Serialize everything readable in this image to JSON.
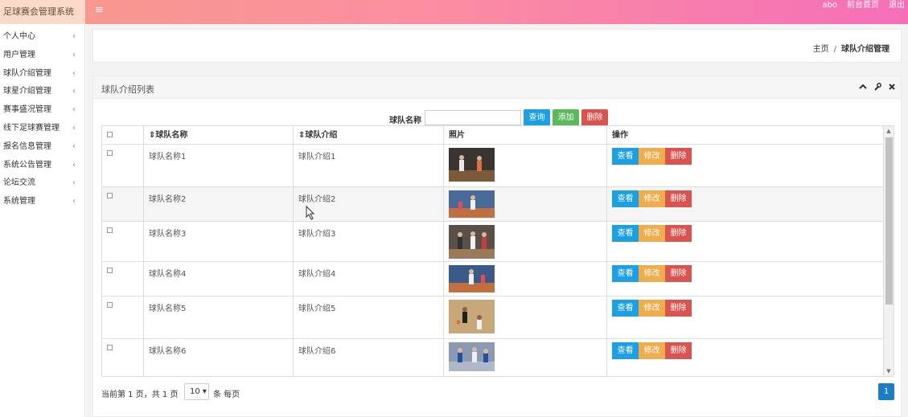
{
  "app": {
    "title": "足球赛会管理系统",
    "menu_icon": "hamburger-icon"
  },
  "top_nav": {
    "user": "abo",
    "front_page": "前台首页",
    "logout": "退出"
  },
  "sidebar": {
    "items": [
      {
        "label": "个人中心"
      },
      {
        "label": "用户管理"
      },
      {
        "label": "球队介绍管理"
      },
      {
        "label": "球星介绍管理"
      },
      {
        "label": "赛事盛况管理"
      },
      {
        "label": "线下足球赛管理"
      },
      {
        "label": "报名信息管理"
      },
      {
        "label": "系统公告管理"
      },
      {
        "label": "论坛交流"
      },
      {
        "label": "系统管理"
      }
    ],
    "chevron": "‹"
  },
  "breadcrumb": {
    "home": "主页",
    "separator": "/",
    "current": "球队介绍管理"
  },
  "panel": {
    "title": "球队介绍列表",
    "tools": {
      "collapse": "⌃",
      "wrench": "🔧",
      "close": "✖"
    }
  },
  "search": {
    "label": "球队名称",
    "value": "",
    "placeholder": "",
    "query_btn": "查询",
    "add_btn": "添加",
    "delete_btn": "删除"
  },
  "table": {
    "headers": {
      "name": "⇕球队名称",
      "intro": "⇕球队介绍",
      "photo": "照片",
      "ops": "操作"
    },
    "actions": {
      "view": "查看",
      "edit": "修改",
      "delete": "删除"
    },
    "rows": [
      {
        "name": "球队名称1",
        "intro": "球队介绍1"
      },
      {
        "name": "球队名称2",
        "intro": "球队介绍2"
      },
      {
        "name": "球队名称3",
        "intro": "球队介绍3"
      },
      {
        "name": "球队名称4",
        "intro": "球队介绍4"
      },
      {
        "name": "球队名称5",
        "intro": "球队介绍5"
      },
      {
        "name": "球队名称6",
        "intro": "球队介绍6"
      }
    ]
  },
  "pager": {
    "summary": "当前第 1 页，共 1 页",
    "page_size": "10 ▾",
    "per_page": "条 每页",
    "current_page": "1"
  },
  "colors": {
    "primary": "#1c9fe3",
    "success": "#5cb85c",
    "warning": "#f0ad4e",
    "danger": "#d9534f"
  }
}
